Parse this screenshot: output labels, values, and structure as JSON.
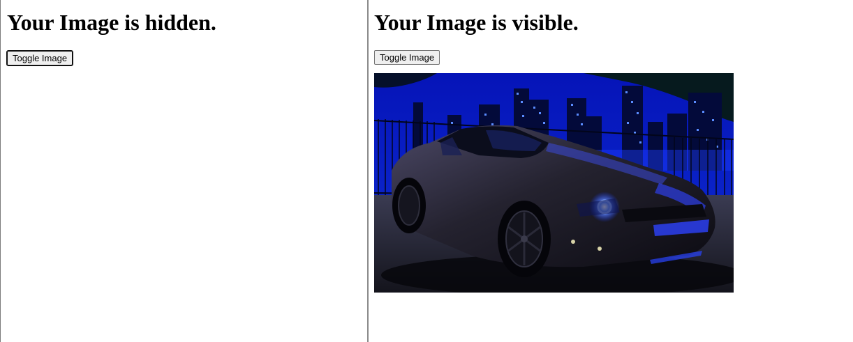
{
  "left_panel": {
    "title": "Your Image is hidden.",
    "button_label": "Toggle Image"
  },
  "right_panel": {
    "title": "Your Image is visible.",
    "button_label": "Toggle Image",
    "image": {
      "subject": "Black sports car at night in front of a blue-lit city skyline"
    }
  },
  "colors": {
    "sky": "#0a18a8",
    "city_lights": "#3a6cff",
    "car_body": "#1c1a26",
    "headlight": "#2f5bff",
    "ground": "#2a2a34"
  }
}
